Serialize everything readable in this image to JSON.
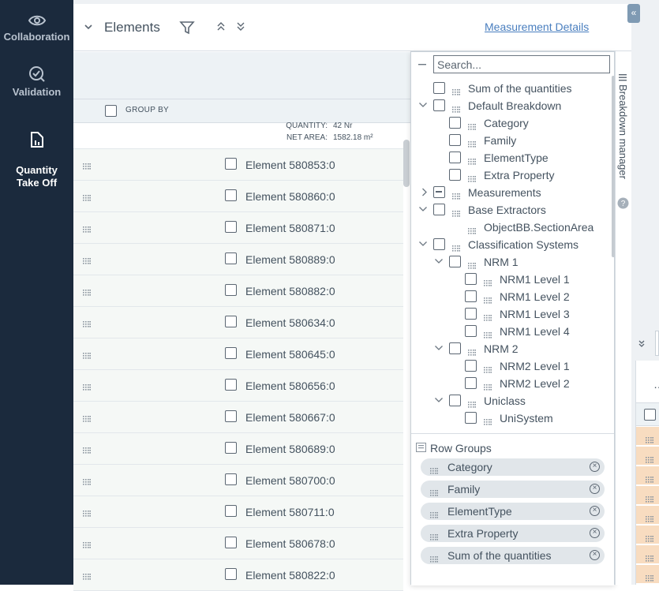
{
  "nav": {
    "items": [
      {
        "label": "Collaboration",
        "icon": "eye-icon"
      },
      {
        "label": "Validation",
        "icon": "check-circle-icon"
      },
      {
        "label": "Quantity\nTake Off",
        "icon": "quantity-chart-icon",
        "active": true
      }
    ]
  },
  "header": {
    "title": "Elements",
    "link": "Measurement Details"
  },
  "grid": {
    "group_by": "GROUP BY",
    "summary": {
      "quantity_label": "QUANTITY:",
      "quantity_value": "42 Nr",
      "net_area_label": "NET AREA:",
      "net_area_value": "1582.18 m²"
    },
    "rows": [
      "Element 580853:0",
      "Element 580860:0",
      "Element 580871:0",
      "Element 580889:0",
      "Element 580882:0",
      "Element 580634:0",
      "Element 580645:0",
      "Element 580656:0",
      "Element 580667:0",
      "Element 580689:0",
      "Element 580700:0",
      "Element 580711:0",
      "Element 580678:0",
      "Element 580822:0"
    ]
  },
  "breakdown": {
    "search_placeholder": "Search...",
    "tree": [
      {
        "label": "Sum of the quantities",
        "level": 0,
        "chevron": ""
      },
      {
        "label": "Default Breakdown",
        "level": 0,
        "chevron": "down"
      },
      {
        "label": "Category",
        "level": 1,
        "chevron": ""
      },
      {
        "label": "Family",
        "level": 1,
        "chevron": ""
      },
      {
        "label": "ElementType",
        "level": 1,
        "chevron": ""
      },
      {
        "label": "Extra Property",
        "level": 1,
        "chevron": ""
      },
      {
        "label": "Measurements",
        "level": 0,
        "chevron": "right",
        "indeterminate": true
      },
      {
        "label": "Base Extractors",
        "level": 0,
        "chevron": "down"
      },
      {
        "label": "ObjectBB.SectionArea",
        "level": 1,
        "chevron": "",
        "nocheck": true
      },
      {
        "label": "Classification Systems",
        "level": 0,
        "chevron": "down"
      },
      {
        "label": "NRM 1",
        "level": 1,
        "chevron": "down"
      },
      {
        "label": "NRM1 Level 1",
        "level": 2,
        "chevron": ""
      },
      {
        "label": "NRM1 Level 2",
        "level": 2,
        "chevron": ""
      },
      {
        "label": "NRM1 Level 3",
        "level": 2,
        "chevron": ""
      },
      {
        "label": "NRM1 Level 4",
        "level": 2,
        "chevron": ""
      },
      {
        "label": "NRM 2",
        "level": 1,
        "chevron": "down"
      },
      {
        "label": "NRM2 Level 1",
        "level": 2,
        "chevron": ""
      },
      {
        "label": "NRM2 Level 2",
        "level": 2,
        "chevron": ""
      },
      {
        "label": "Uniclass",
        "level": 1,
        "chevron": "down"
      },
      {
        "label": "UniSystem",
        "level": 2,
        "chevron": ""
      }
    ],
    "row_groups_title": "Row Groups",
    "row_groups": [
      "Category",
      "Family",
      "ElementType",
      "Extra Property",
      "Sum of the quantities"
    ],
    "side_label": "Breakdown manager"
  }
}
